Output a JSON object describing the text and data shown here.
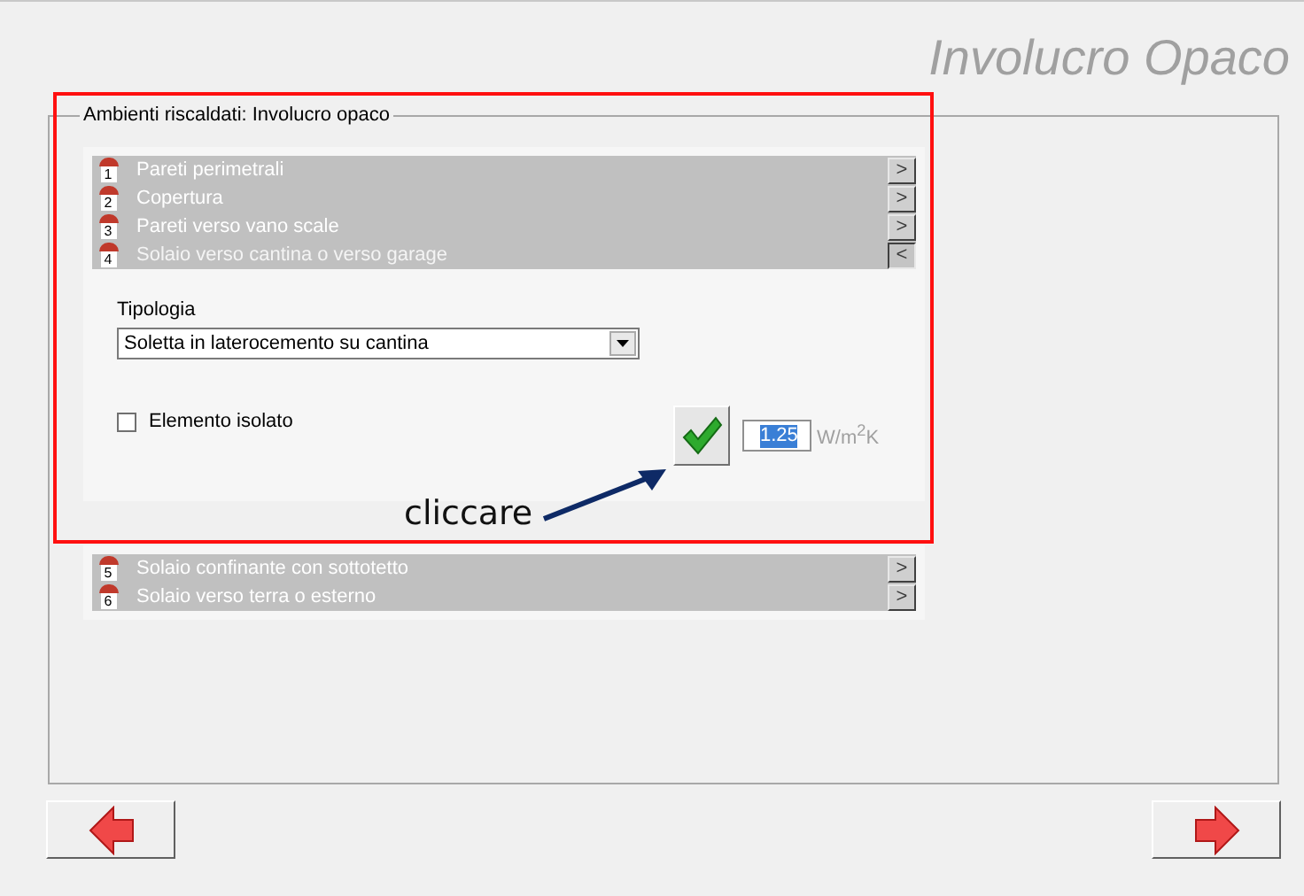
{
  "header": {
    "title": "Involucro Opaco"
  },
  "group": {
    "title": "Ambienti riscaldati: Involucro opaco",
    "sections": [
      {
        "number": "1",
        "label": "Pareti perimetrali",
        "toggle": ">",
        "expanded": false
      },
      {
        "number": "2",
        "label": "Copertura",
        "toggle": ">",
        "expanded": false
      },
      {
        "number": "3",
        "label": "Pareti verso vano scale",
        "toggle": ">",
        "expanded": false
      },
      {
        "number": "4",
        "label": "Solaio verso cantina o verso garage",
        "toggle": "<",
        "expanded": true
      },
      {
        "number": "5",
        "label": "Solaio confinante con sottotetto",
        "toggle": ">",
        "expanded": false
      },
      {
        "number": "6",
        "label": "Solaio verso terra o esterno",
        "toggle": ">",
        "expanded": false
      }
    ],
    "form": {
      "type_label": "Tipologia",
      "type_value": "Soletta in laterocemento su cantina",
      "insulated": {
        "label": "Elemento isolato",
        "checked": false
      },
      "u_value": "1.25",
      "unit": "W/m$^{2}$K"
    }
  },
  "annotation": {
    "text": "cliccare"
  }
}
